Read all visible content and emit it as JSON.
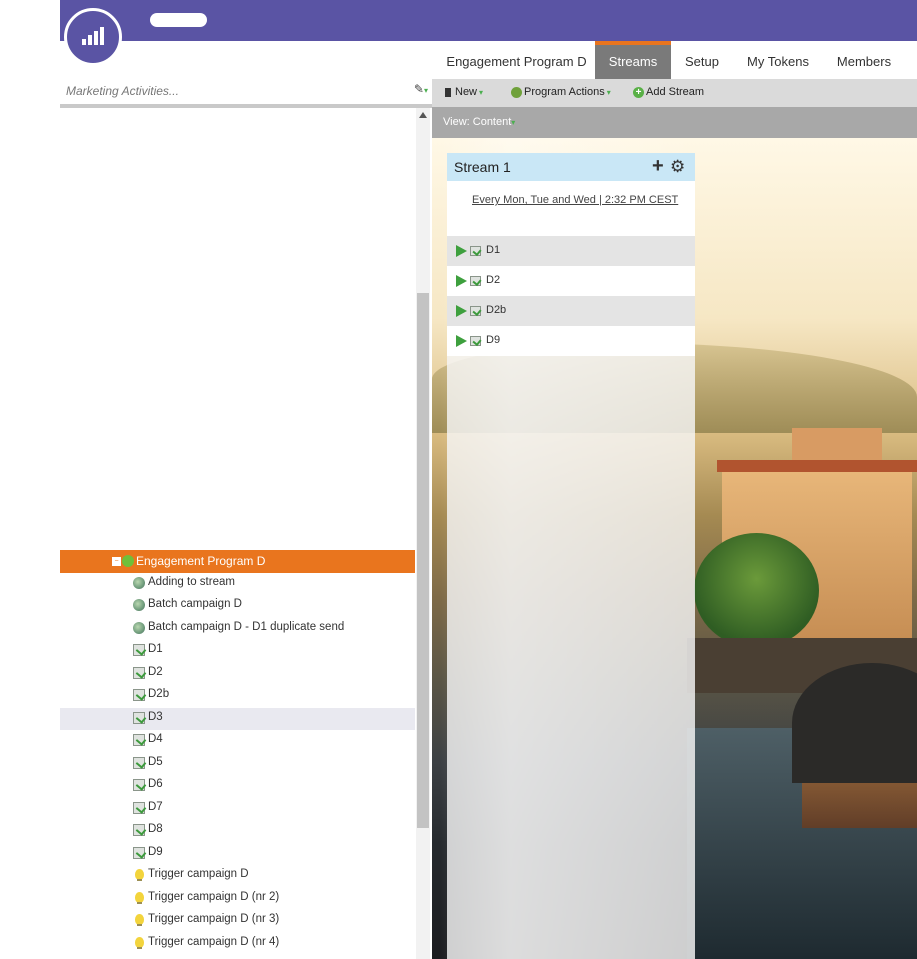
{
  "search": {
    "placeholder": "Marketing Activities..."
  },
  "tree": {
    "selected": {
      "label": "Engagement Program D",
      "icon": "engagement-program-icon"
    },
    "items": [
      {
        "label": "Adding to stream",
        "icon": "campaign-icon"
      },
      {
        "label": "Batch campaign D",
        "icon": "campaign-icon"
      },
      {
        "label": "Batch campaign D - D1 duplicate send",
        "icon": "campaign-icon"
      },
      {
        "label": "D1",
        "icon": "email-icon"
      },
      {
        "label": "D2",
        "icon": "email-icon"
      },
      {
        "label": "D2b",
        "icon": "email-icon"
      },
      {
        "label": "D3",
        "icon": "email-icon"
      },
      {
        "label": "D4",
        "icon": "email-icon"
      },
      {
        "label": "D5",
        "icon": "email-icon"
      },
      {
        "label": "D6",
        "icon": "email-icon"
      },
      {
        "label": "D7",
        "icon": "email-icon"
      },
      {
        "label": "D8",
        "icon": "email-icon"
      },
      {
        "label": "D9",
        "icon": "email-icon"
      },
      {
        "label": "Trigger campaign D",
        "icon": "trigger-bulb-icon"
      },
      {
        "label": "Trigger campaign D (nr 2)",
        "icon": "trigger-bulb-icon"
      },
      {
        "label": "Trigger campaign D (nr 3)",
        "icon": "trigger-bulb-icon"
      },
      {
        "label": "Trigger campaign D (nr 4)",
        "icon": "trigger-bulb-icon"
      }
    ]
  },
  "tabs": [
    {
      "label": "Engagement Program D",
      "active": false
    },
    {
      "label": "Streams",
      "active": true
    },
    {
      "label": "Setup",
      "active": false
    },
    {
      "label": "My Tokens",
      "active": false
    },
    {
      "label": "Members",
      "active": false
    }
  ],
  "toolbar": {
    "new_label": "New",
    "program_actions_label": "Program Actions",
    "add_stream_label": "Add Stream"
  },
  "view": {
    "label": "View: Content"
  },
  "stream": {
    "title": "Stream 1",
    "cadence": "Every Mon, Tue and Wed | 2:32 PM CEST",
    "contents": [
      {
        "label": "D1"
      },
      {
        "label": "D2"
      },
      {
        "label": "D2b"
      },
      {
        "label": "D9"
      }
    ]
  },
  "colors": {
    "header": "#5a54a4",
    "accent_orange": "#e9751e",
    "stream_header": "#c9e7f6",
    "play_green": "#3ea03e"
  }
}
